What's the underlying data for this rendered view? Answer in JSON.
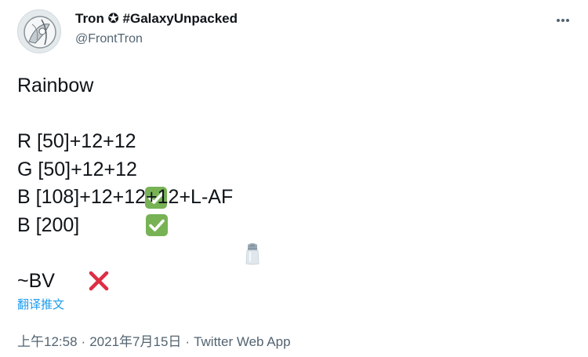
{
  "author": {
    "display_name": "Tron ✪ #GalaxyUnpacked",
    "handle": "@FrontTron"
  },
  "tweet": {
    "lines": [
      {
        "text": "Rainbow",
        "emoji": ""
      },
      {
        "text": "",
        "emoji": ""
      },
      {
        "text": "R [50]+12+12",
        "emoji": "check-mark-icon"
      },
      {
        "text": "G [50]+12+12",
        "emoji": "check-mark-icon"
      },
      {
        "text": "B [108]+12+12+12+L-AF",
        "emoji": "salt-shaker-icon"
      },
      {
        "text": "B [200]",
        "emoji": "cross-mark-icon"
      },
      {
        "text": "",
        "emoji": ""
      },
      {
        "text": "~BV",
        "emoji": ""
      }
    ],
    "translate_label": "翻译推文"
  },
  "meta": {
    "time": "上午12:58",
    "separator": "·",
    "date": "2021年7月15日",
    "source": "Twitter Web App"
  },
  "colors": {
    "text": "#0f1419",
    "secondary": "#536471",
    "link": "#1d9bf0",
    "check_green": "#77b255",
    "cross_red": "#dd2e44"
  }
}
